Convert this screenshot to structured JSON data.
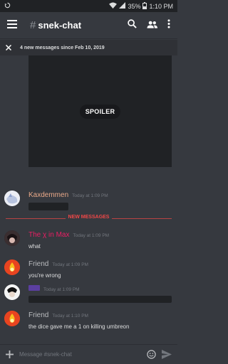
{
  "status_bar": {
    "battery": "35%",
    "time": "1:10 PM"
  },
  "header": {
    "channel_prefix": "#",
    "channel": "snek-chat"
  },
  "banner": {
    "text": "4 new messages since Feb 10, 2019"
  },
  "spoiler": {
    "label": "SPOILER"
  },
  "messages": [
    {
      "author": "Kaxdemmen",
      "author_color": "#e8a888",
      "timestamp": "Today at 1:09 PM",
      "text": "",
      "redacted": true
    },
    {
      "author": "The χ in Max",
      "author_color": "#e91e63",
      "timestamp": "Today at 1:09 PM",
      "text": "what",
      "redacted": false
    },
    {
      "author": "Friend",
      "author_color": "#b9bbbe",
      "timestamp": "Today at 1:09 PM",
      "text": "you're wrong",
      "redacted": false
    },
    {
      "author": "",
      "author_color": "#7b5cc4",
      "timestamp": "Today at 1:09 PM",
      "text": "",
      "redacted": true
    },
    {
      "author": "Friend",
      "author_color": "#b9bbbe",
      "timestamp": "Today at 1:10 PM",
      "text": "the dice gave me a 1 on killing umbreon",
      "redacted": false
    }
  ],
  "divider": {
    "label": "NEW MESSAGES"
  },
  "composer": {
    "placeholder": "Message #snek-chat"
  },
  "colors": {
    "background": "#36393f",
    "divider": "#f04747"
  }
}
